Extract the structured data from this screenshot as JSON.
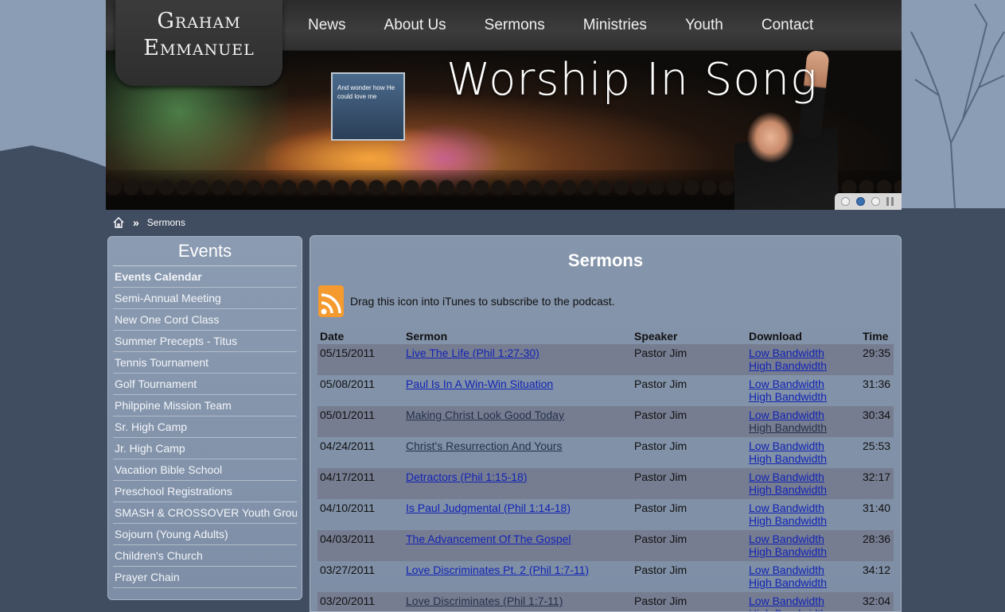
{
  "logo": {
    "line1": "Graham",
    "line2": "Emmanuel"
  },
  "nav": [
    {
      "label": "News"
    },
    {
      "label": "About Us"
    },
    {
      "label": "Sermons"
    },
    {
      "label": "Ministries"
    },
    {
      "label": "Youth"
    },
    {
      "label": "Contact"
    }
  ],
  "banner": {
    "title": "Worship In Song",
    "screen_text": "And wonder how He could love me"
  },
  "breadcrumb": {
    "separator": "»",
    "current": "Sermons"
  },
  "sidebar": {
    "title": "Events",
    "items": [
      {
        "label": "Events Calendar"
      },
      {
        "label": "Semi-Annual Meeting"
      },
      {
        "label": "New One Cord Class"
      },
      {
        "label": "Summer Precepts - Titus"
      },
      {
        "label": "Tennis Tournament"
      },
      {
        "label": "Golf Tournament"
      },
      {
        "label": "Philppine Mission Team"
      },
      {
        "label": "Sr. High Camp"
      },
      {
        "label": "Jr. High Camp"
      },
      {
        "label": "Vacation Bible School"
      },
      {
        "label": "Preschool Registrations"
      },
      {
        "label": "SMASH & CROSSOVER Youth Grou"
      },
      {
        "label": "Sojourn (Young Adults)"
      },
      {
        "label": "Children's Church"
      },
      {
        "label": "Prayer Chain"
      }
    ]
  },
  "main": {
    "title": "Sermons",
    "podcast_text": "Drag this icon into iTunes to subscribe to the podcast.",
    "columns": {
      "date": "Date",
      "sermon": "Sermon",
      "speaker": "Speaker",
      "download": "Download",
      "time": "Time"
    },
    "low_label": "Low Bandwidth",
    "high_label": "High Bandwidth",
    "rows": [
      {
        "date": "05/15/2011",
        "sermon": "Live The Life (Phil 1:27-30)",
        "speaker": "Pastor Jim",
        "time": "29:35"
      },
      {
        "date": "05/08/2011",
        "sermon": "Paul Is In A Win-Win Situation",
        "speaker": "Pastor Jim",
        "time": "31:36"
      },
      {
        "date": "05/01/2011",
        "sermon": "Making Christ Look Good Today",
        "speaker": "Pastor Jim",
        "time": "30:34"
      },
      {
        "date": "04/24/2011",
        "sermon": "Christ's Resurrection And Yours",
        "speaker": "Pastor Jim",
        "time": "25:53"
      },
      {
        "date": "04/17/2011",
        "sermon": "Detractors (Phil 1:15-18)",
        "speaker": "Pastor Jim",
        "time": "32:17"
      },
      {
        "date": "04/10/2011",
        "sermon": "Is Paul Judgmental (Phil 1:14-18)",
        "speaker": "Pastor Jim",
        "time": "31:40"
      },
      {
        "date": "04/03/2011",
        "sermon": "The Advancement Of The Gospel",
        "speaker": "Pastor Jim",
        "time": "28:36"
      },
      {
        "date": "03/27/2011",
        "sermon": "Love Discriminates Pt. 2 (Phil 1:7-11)",
        "speaker": "Pastor Jim",
        "time": "34:12"
      },
      {
        "date": "03/20/2011",
        "sermon": "Love Discriminates (Phil 1:7-11)",
        "speaker": "Pastor Jim",
        "time": "32:04"
      }
    ]
  },
  "colors": {
    "link": "#1224b4",
    "visited_link": "#23304a",
    "background": "#3f4c60",
    "panel": "#8595ab"
  }
}
